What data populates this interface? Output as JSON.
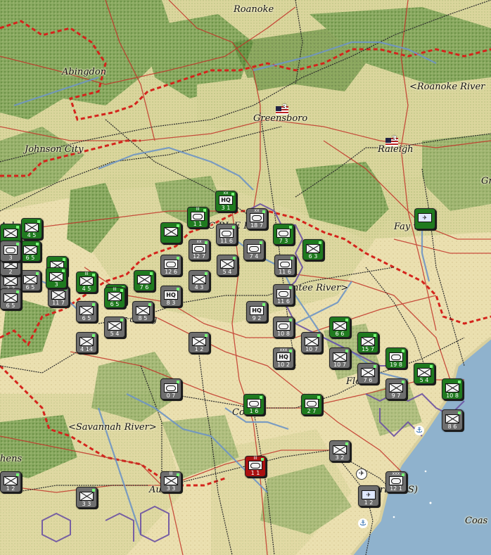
{
  "cities": [
    {
      "id": "roanoke",
      "name": "Roanoke"
    },
    {
      "id": "abingdon",
      "name": "Abingdon"
    },
    {
      "id": "roanoke-river",
      "name": "<Roanoke River"
    },
    {
      "id": "greensboro",
      "name": "Greensboro"
    },
    {
      "id": "johnson-city",
      "name": "Johnson City"
    },
    {
      "id": "raleigh",
      "name": "Raleigh"
    },
    {
      "id": "asheville",
      "name": "Asheville"
    },
    {
      "id": "fayetteville",
      "name": "Fay    ville"
    },
    {
      "id": "charlotte",
      "name": "C    RL    E   R)"
    },
    {
      "id": "santee-river",
      "name": "ntee River>"
    },
    {
      "id": "spartanburg",
      "name": "r   aburg"
    },
    {
      "id": "florence",
      "name": "Flo     c"
    },
    {
      "id": "columbia",
      "name": "Co    bia"
    },
    {
      "id": "savannah-river",
      "name": "<Savannah River>"
    },
    {
      "id": "athens",
      "name": "hens"
    },
    {
      "id": "augusta",
      "name": "Au   a"
    },
    {
      "id": "charleston",
      "name": "rl   on (S)"
    },
    {
      "id": "coast",
      "name": "Coas"
    },
    {
      "id": "gr",
      "name": "Gr"
    }
  ],
  "capital_badges": [
    {
      "city": "greensboro",
      "value": "3"
    },
    {
      "city": "raleigh",
      "value": "3"
    }
  ],
  "units": [
    {
      "id": "u1",
      "color": "green",
      "type": "hq",
      "size": "xx",
      "str": "3  1"
    },
    {
      "id": "u2",
      "color": "green",
      "type": "armor",
      "size": "III",
      "str": "1  1"
    },
    {
      "id": "u3",
      "color": "green",
      "type": "x",
      "size": "",
      "str": ""
    },
    {
      "id": "u4",
      "color": "grey",
      "type": "armor",
      "size": "xx",
      "str": "18  7"
    },
    {
      "id": "u5",
      "color": "green",
      "type": "armor",
      "size": "",
      "str": "7  3"
    },
    {
      "id": "u6",
      "color": "green",
      "type": "x",
      "size": "",
      "str": "6  3"
    },
    {
      "id": "u7",
      "color": "grey",
      "type": "armor",
      "size": "",
      "str": "12  6"
    },
    {
      "id": "u8",
      "color": "grey",
      "type": "armor",
      "size": "",
      "str": "7  4"
    },
    {
      "id": "u9",
      "color": "grey",
      "type": "armor",
      "size": "",
      "str": "11  6"
    },
    {
      "id": "u10",
      "color": "green",
      "type": "x",
      "size": "",
      "str": "3"
    },
    {
      "id": "u11",
      "color": "grey",
      "type": "x",
      "size": "",
      "str": "5  4"
    },
    {
      "id": "u12",
      "color": "grey",
      "type": "x",
      "size": "",
      "str": "4  3"
    },
    {
      "id": "u13",
      "color": "grey",
      "type": "armor",
      "size": "xx",
      "str": "12  7"
    },
    {
      "id": "u14",
      "color": "grey",
      "type": "armor",
      "size": "",
      "str": "11  6"
    },
    {
      "id": "u15",
      "color": "green",
      "type": "x",
      "size": "III",
      "str": "4  5"
    },
    {
      "id": "u16",
      "color": "green",
      "type": "x",
      "size": "",
      "str": "6  5"
    },
    {
      "id": "u17",
      "color": "grey",
      "type": "x",
      "size": "",
      "str": "6  5"
    },
    {
      "id": "u18",
      "color": "green",
      "type": "x",
      "size": "",
      "str": "7  6"
    },
    {
      "id": "u19",
      "color": "green",
      "type": "x",
      "size": "",
      "str": "8  3"
    },
    {
      "id": "u20",
      "color": "grey",
      "type": "x",
      "size": "",
      "str": "11  7"
    },
    {
      "id": "u21",
      "color": "green",
      "type": "x",
      "size": "III",
      "str": "6  5"
    },
    {
      "id": "u22",
      "color": "green",
      "type": "x",
      "size": "",
      "str": ""
    },
    {
      "id": "u23",
      "color": "grey",
      "type": "hq",
      "size": "",
      "str": "8  3"
    },
    {
      "id": "u24",
      "color": "grey",
      "type": "x",
      "size": "",
      "str": "6  5"
    },
    {
      "id": "u25",
      "color": "grey",
      "type": "x",
      "size": "",
      "str": "8  5"
    },
    {
      "id": "u26",
      "color": "grey",
      "type": "x",
      "size": "",
      "str": "5  4"
    },
    {
      "id": "u27",
      "color": "grey",
      "type": "hq",
      "size": "",
      "str": "9  2"
    },
    {
      "id": "u28",
      "color": "grey",
      "type": "armor",
      "size": "",
      "str": "11  6"
    },
    {
      "id": "u29",
      "color": "grey",
      "type": "armor",
      "size": "",
      "str": "10  8"
    },
    {
      "id": "u30",
      "color": "grey",
      "type": "x",
      "size": "",
      "str": "10  7"
    },
    {
      "id": "u31",
      "color": "grey",
      "type": "hq",
      "size": "xxx",
      "str": "10  2"
    },
    {
      "id": "u32",
      "color": "green",
      "type": "x",
      "size": "",
      "str": "6  6"
    },
    {
      "id": "u33",
      "color": "green",
      "type": "x",
      "size": "",
      "str": "15  7"
    },
    {
      "id": "u34",
      "color": "grey",
      "type": "x",
      "size": "",
      "str": "10  7"
    },
    {
      "id": "u35",
      "color": "grey",
      "type": "x",
      "size": "",
      "str": "7  6"
    },
    {
      "id": "u36",
      "color": "green",
      "type": "armor",
      "size": "",
      "str": "19  8"
    },
    {
      "id": "u37",
      "color": "grey",
      "type": "x",
      "size": "",
      "str": "9  7"
    },
    {
      "id": "u38",
      "color": "green",
      "type": "x",
      "size": "",
      "str": "5  4"
    },
    {
      "id": "u39",
      "color": "green",
      "type": "x",
      "size": "",
      "str": "10  8"
    },
    {
      "id": "u40",
      "color": "grey",
      "type": "x",
      "size": "",
      "str": "8  6"
    },
    {
      "id": "u41",
      "color": "grey",
      "type": "x",
      "size": "",
      "str": "4  14"
    },
    {
      "id": "u42",
      "color": "grey",
      "type": "x",
      "size": "",
      "str": "1  2"
    },
    {
      "id": "u43",
      "color": "grey",
      "type": "armor",
      "size": "",
      "str": "0  7"
    },
    {
      "id": "u44",
      "color": "green",
      "type": "armor",
      "size": "",
      "str": "1  6"
    },
    {
      "id": "u45",
      "color": "green",
      "type": "armor",
      "size": "",
      "str": "2  7"
    },
    {
      "id": "u46",
      "color": "grey",
      "type": "x",
      "size": "",
      "str": "3  2"
    },
    {
      "id": "u47",
      "color": "red",
      "type": "armor",
      "size": "III",
      "str": "1  1"
    },
    {
      "id": "u48",
      "color": "grey",
      "type": "x",
      "size": "",
      "str": "3  3"
    },
    {
      "id": "u49",
      "color": "grey",
      "type": "x",
      "size": "III",
      "str": "3  3"
    },
    {
      "id": "u50",
      "color": "grey",
      "type": "armor",
      "size": "xxx",
      "str": "12  1"
    },
    {
      "id": "u51",
      "color": "grey",
      "type": "x",
      "size": "",
      "str": "1  2"
    },
    {
      "id": "u52",
      "color": "grey",
      "type": "x",
      "size": "",
      "str": "3  3"
    },
    {
      "id": "u53",
      "color": "grey",
      "type": "x",
      "size": "",
      "str": "6  5"
    },
    {
      "id": "u54",
      "color": "green",
      "type": "x",
      "size": "",
      "str": "4  5"
    },
    {
      "id": "u55",
      "color": "grey",
      "type": "x",
      "size": "",
      "str": "2"
    },
    {
      "id": "u56",
      "color": "green",
      "type": "x",
      "size": "",
      "str": "3"
    },
    {
      "id": "u57",
      "color": "grey",
      "type": "armor",
      "size": "",
      "str": "3"
    }
  ],
  "colors": {
    "sea": "#8fb2cd",
    "land": "#e9dfb2",
    "forest": "#7fa05c",
    "dark_forest": "#4f7e32",
    "frontline": "#d4241c",
    "road": "#c2352a",
    "rail": "#333333",
    "river": "#6f95c4"
  }
}
